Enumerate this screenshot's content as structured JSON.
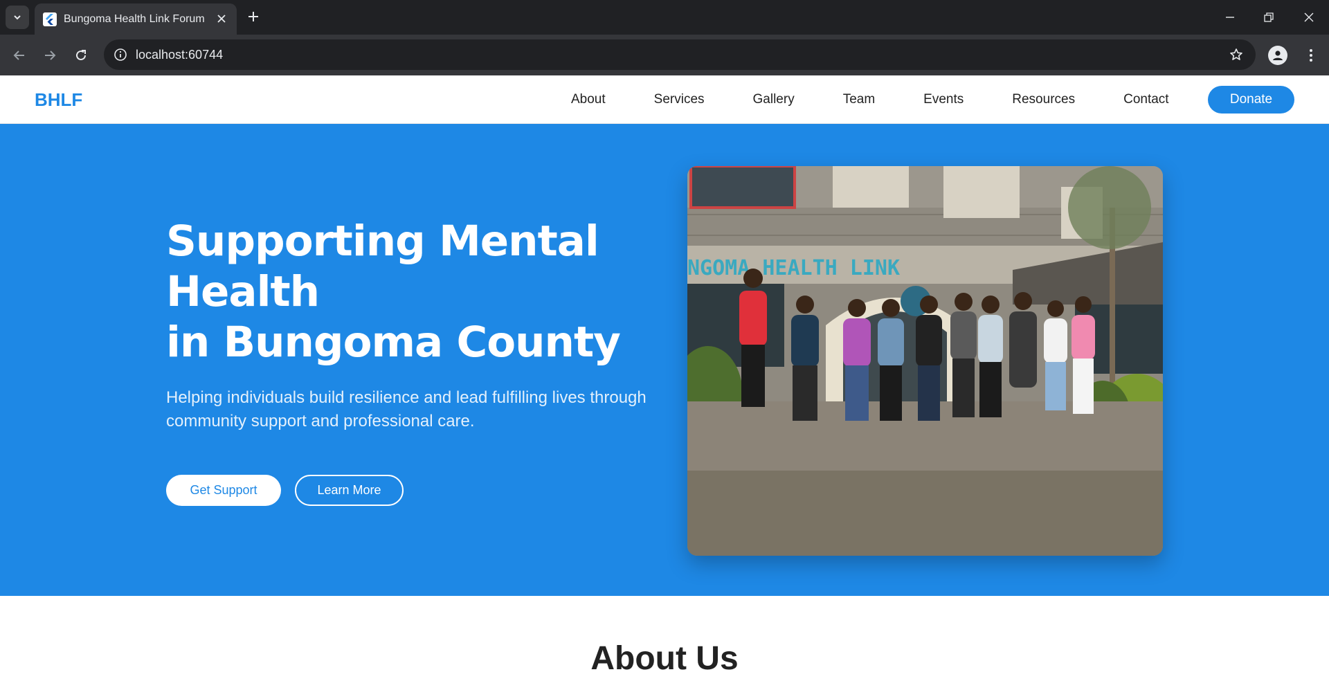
{
  "browser": {
    "tab_title": "Bungoma Health Link Forum",
    "url": "localhost:60744",
    "icons": {
      "tab_menu": "chevron-down-icon",
      "favicon": "flutter-icon",
      "tab_close": "close-icon",
      "new_tab": "plus-icon",
      "minimize": "minimize-icon",
      "restore": "restore-icon",
      "close_window": "close-icon",
      "back": "arrow-left-icon",
      "forward": "arrow-right-icon",
      "reload": "reload-icon",
      "site_info": "info-icon",
      "bookmark": "star-icon",
      "profile": "person-icon",
      "menu": "kebab-icon"
    }
  },
  "site": {
    "logo": "BHLF",
    "nav": [
      "About",
      "Services",
      "Gallery",
      "Team",
      "Events",
      "Resources",
      "Contact"
    ],
    "donate_label": "Donate",
    "brand_color": "#1e88e5"
  },
  "hero": {
    "title_line1": "Supporting Mental",
    "title_line2": "Health",
    "title_line3": "in Bungoma County",
    "subtitle": "Helping individuals build resilience and lead fulfilling lives through community support and professional care.",
    "primary_button": "Get Support",
    "secondary_button": "Learn More",
    "image_sign_text": "NGOMA HEALTH LINK"
  },
  "about": {
    "title": "About Us"
  }
}
